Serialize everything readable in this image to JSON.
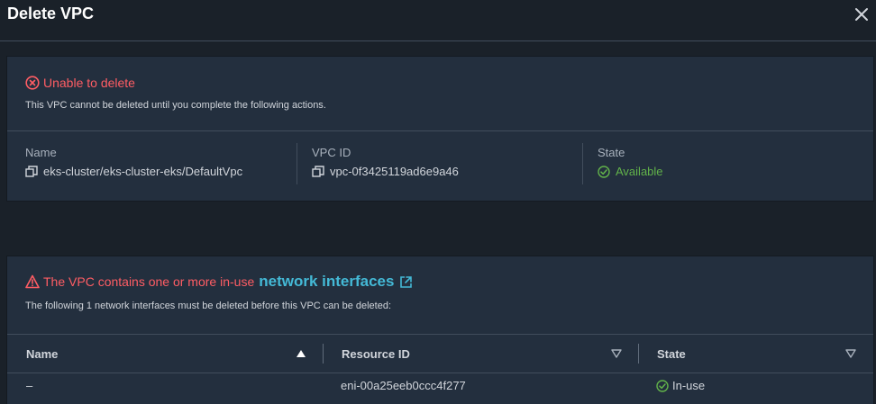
{
  "modal": {
    "title": "Delete VPC"
  },
  "alert_delete": {
    "title": "Unable to delete",
    "description": "This VPC cannot be deleted until you complete the following actions."
  },
  "vpc_details": {
    "name_label": "Name",
    "name_value": "eks-cluster/eks-cluster-eks/DefaultVpc",
    "id_label": "VPC ID",
    "id_value": "vpc-0f3425119ad6e9a46",
    "state_label": "State",
    "state_value": "Available"
  },
  "alert_interfaces": {
    "title": "The VPC contains one or more in-use",
    "link_text": "network interfaces",
    "description": "The following 1 network interfaces must be deleted before this VPC can be deleted:"
  },
  "table": {
    "columns": [
      "Name",
      "Resource ID",
      "State"
    ],
    "rows": [
      {
        "name": "–",
        "resource_id": "eni-00a25eeb0ccc4f277",
        "state": "In-use"
      }
    ]
  },
  "colors": {
    "error": "#ff5d64",
    "success": "#62b34a",
    "link": "#44b9d6",
    "panel": "#232f3e",
    "background": "#1a2129"
  }
}
